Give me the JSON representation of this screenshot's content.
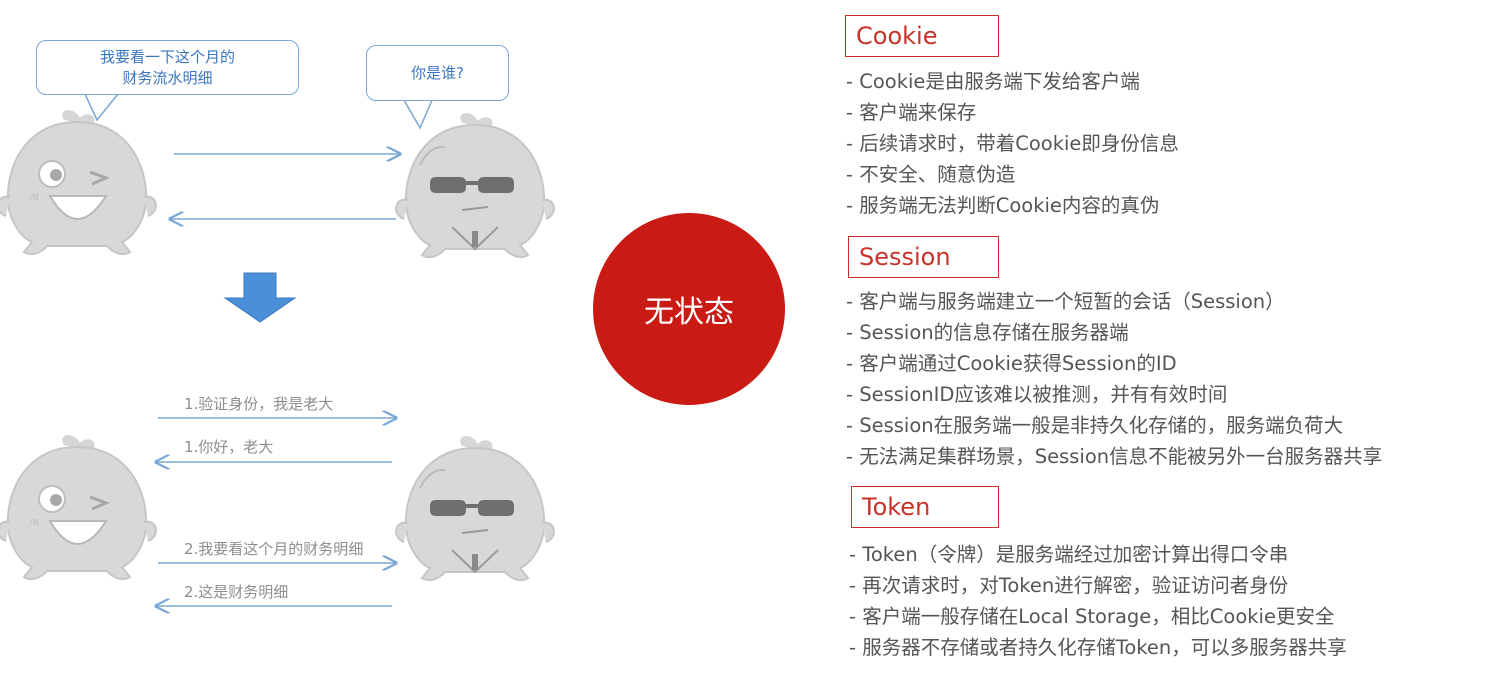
{
  "center": {
    "label": "无状态"
  },
  "scene_top": {
    "client_bubble": [
      "我要看一下这个月的",
      "财务流水明细"
    ],
    "server_bubble": "你是谁?"
  },
  "scene_bottom": {
    "messages": [
      "1.验证身份，我是老大",
      "1.你好，老大",
      "2.我要看这个月的财务明细",
      "2.这是财务明细"
    ]
  },
  "sections": [
    {
      "title": "Cookie",
      "items": [
        "- Cookie是由服务端下发给客户端",
        "- 客户端来保存",
        "- 后续请求时，带着Cookie即身份信息",
        "- 不安全、随意伪造",
        "- 服务端无法判断Cookie内容的真伪"
      ]
    },
    {
      "title": "Session",
      "items": [
        "- 客户端与服务端建立一个短暂的会话（Session）",
        "- Session的信息存储在服务器端",
        "- 客户端通过Cookie获得Session的ID",
        "- SessionID应该难以被推测，并有有效时间",
        "- Session在服务端一般是非持久化存储的，服务端负荷大",
        "- 无法满足集群场景，Session信息不能被另外一台服务器共享"
      ]
    },
    {
      "title": "Token",
      "items": [
        "- Token（令牌）是服务端经过加密计算出得口令串",
        "- 再次请求时，对Token进行解密，验证访问者身份",
        "- 客户端一般存储在Local Storage，相比Cookie更安全",
        "- 服务器不存储或者持久化存储Token，可以多服务器共享"
      ]
    }
  ],
  "colors": {
    "accent": "#c91a13",
    "arrow": "#4a90d9",
    "bubble_border": "#7aa7d6",
    "mascot": "#cfcfcf"
  }
}
